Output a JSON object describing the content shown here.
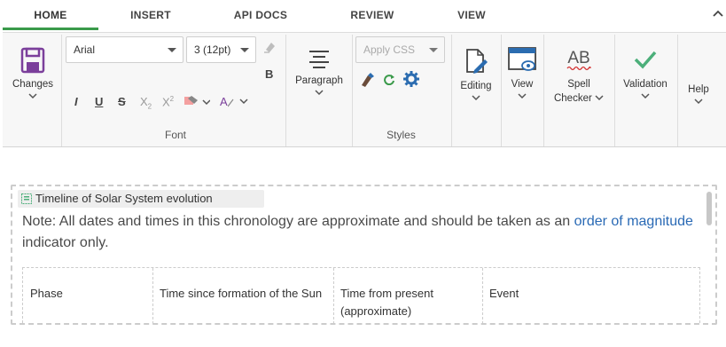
{
  "tabs": [
    {
      "label": "HOME",
      "active": true
    },
    {
      "label": "INSERT"
    },
    {
      "label": "API DOCS"
    },
    {
      "label": "REVIEW"
    },
    {
      "label": "VIEW"
    }
  ],
  "ribbon": {
    "changes_label": "Changes",
    "font": {
      "family": "Arial",
      "size": "3 (12pt)",
      "group_label": "Font",
      "bold": "B",
      "italic": "I",
      "underline": "U",
      "strike": "S",
      "subscript": "X",
      "subscript_mark": "2",
      "superscript": "X",
      "superscript_mark": "2",
      "font_color": "A"
    },
    "paragraph_label": "Paragraph",
    "styles": {
      "apply_css_placeholder": "Apply CSS",
      "group_label": "Styles"
    },
    "editing_label": "Editing",
    "view_label": "View",
    "spell_checker_line1": "Spell",
    "spell_checker_line2": "Checker",
    "spell_icon_text": "AB",
    "validation_label": "Validation",
    "help_label": "Help"
  },
  "colors": {
    "accent_green": "#3a9a4a",
    "brand_purple": "#7b3f9b",
    "link_blue": "#2a6ab5",
    "icon_blue": "#2b6cb0"
  },
  "document": {
    "widget_title": "Timeline of Solar System evolution",
    "note_prefix": "Note: All dates and times in this chronology are approximate and should be taken as an ",
    "note_link": "order of magnitude",
    "note_suffix": " indicator only.",
    "table_headers": [
      "Phase",
      "Time since formation of the Sun",
      "Time from present (approximate)",
      "Event"
    ]
  }
}
